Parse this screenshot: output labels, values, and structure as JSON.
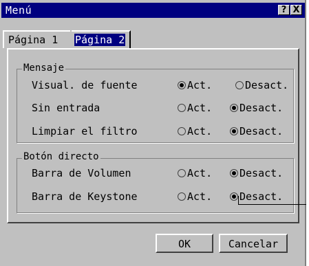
{
  "window": {
    "title": "Menú",
    "help_label": "?",
    "close_label": "X"
  },
  "tabs": [
    {
      "label": "Página 1",
      "selected": false
    },
    {
      "label": "Página 2",
      "selected": true
    }
  ],
  "groups": {
    "mensaje": {
      "label": "Mensaje",
      "rows": [
        {
          "label": "Visual. de fuente",
          "on_label": "Act.",
          "off_label": "Desact.",
          "selected": "on"
        },
        {
          "label": "Sin entrada",
          "on_label": "Act.",
          "off_label": "Desact.",
          "selected": "off"
        },
        {
          "label": "Limpiar el filtro",
          "on_label": "Act.",
          "off_label": "Desact.",
          "selected": "off"
        }
      ]
    },
    "boton_directo": {
      "label": "Botón directo",
      "rows": [
        {
          "label": "Barra de Volumen",
          "on_label": "Act.",
          "off_label": "Desact.",
          "selected": "off"
        },
        {
          "label": "Barra de Keystone",
          "on_label": "Act.",
          "off_label": "Desact.",
          "selected": "off"
        }
      ]
    }
  },
  "buttons": {
    "ok": "OK",
    "cancel": "Cancelar"
  }
}
